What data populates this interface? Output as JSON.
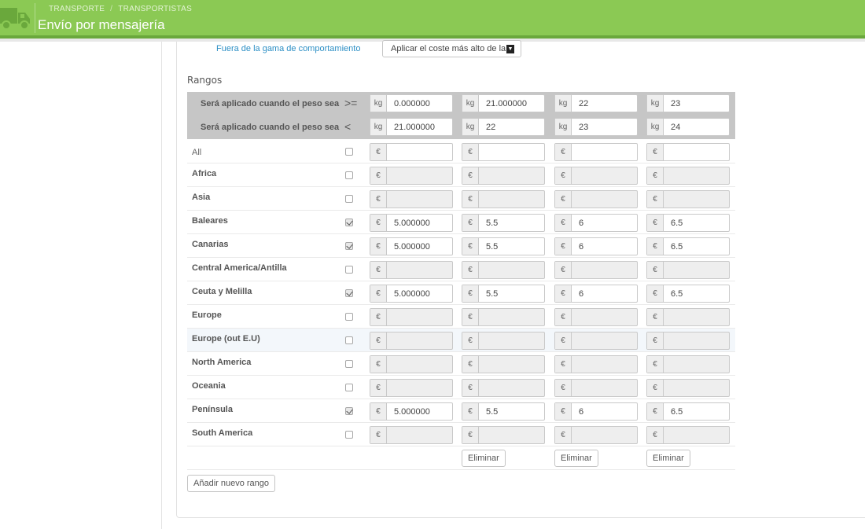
{
  "header": {
    "breadcrumb": [
      "TRANSPORTE",
      "TRANSPORTISTAS"
    ],
    "breadcrumb_sep": "/",
    "title": "Envío por mensajería",
    "icon": "truck-icon"
  },
  "behavior": {
    "label": "Fuera de la gama de comportamiento",
    "selected": "Aplicar el coste más alto de la"
  },
  "ranges_title": "Rangos",
  "weight_rows": [
    {
      "label": "Será aplicado cuando el peso sea",
      "op": ">=",
      "unit": "kg",
      "values": [
        "0.000000",
        "21.000000",
        "22",
        "23"
      ]
    },
    {
      "label": "Será aplicado cuando el peso sea",
      "op": "<",
      "unit": "kg",
      "values": [
        "21.000000",
        "22",
        "23",
        "24"
      ]
    }
  ],
  "currency": "€",
  "zones": [
    {
      "name": "All",
      "checked": false,
      "values": [
        "",
        "",
        "",
        ""
      ]
    },
    {
      "name": "Africa",
      "checked": false,
      "values": [
        "",
        "",
        "",
        ""
      ]
    },
    {
      "name": "Asia",
      "checked": false,
      "values": [
        "",
        "",
        "",
        ""
      ]
    },
    {
      "name": "Baleares",
      "checked": true,
      "values": [
        "5.000000",
        "5.5",
        "6",
        "6.5"
      ]
    },
    {
      "name": "Canarias",
      "checked": true,
      "values": [
        "5.000000",
        "5.5",
        "6",
        "6.5"
      ]
    },
    {
      "name": "Central America/Antilla",
      "checked": false,
      "values": [
        "",
        "",
        "",
        ""
      ]
    },
    {
      "name": "Ceuta y Melilla",
      "checked": true,
      "values": [
        "5.000000",
        "5.5",
        "6",
        "6.5"
      ]
    },
    {
      "name": "Europe",
      "checked": false,
      "values": [
        "",
        "",
        "",
        ""
      ]
    },
    {
      "name": "Europe (out E.U)",
      "checked": false,
      "values": [
        "",
        "",
        "",
        ""
      ]
    },
    {
      "name": "North America",
      "checked": false,
      "values": [
        "",
        "",
        "",
        ""
      ]
    },
    {
      "name": "Oceania",
      "checked": false,
      "values": [
        "",
        "",
        "",
        ""
      ]
    },
    {
      "name": "Península",
      "checked": true,
      "values": [
        "5.000000",
        "5.5",
        "6",
        "6.5"
      ]
    },
    {
      "name": "South America",
      "checked": false,
      "values": [
        "",
        "",
        "",
        ""
      ]
    }
  ],
  "delete_label": "Eliminar",
  "add_range_label": "Añadir nuevo rango"
}
